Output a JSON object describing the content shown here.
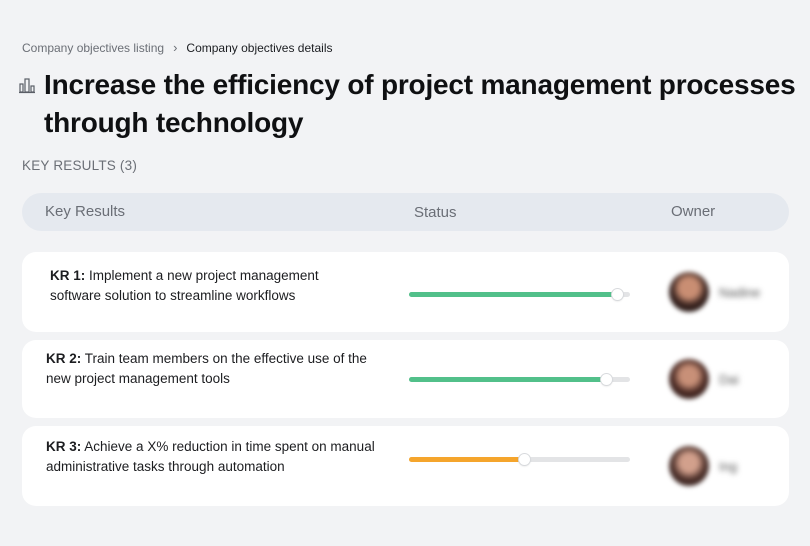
{
  "breadcrumb": {
    "parent": "Company objectives listing",
    "separator": "›",
    "current": "Company objectives details"
  },
  "title": "Increase the efficiency of project management processes through technology",
  "section_label": "KEY RESULTS (3)",
  "table": {
    "headers": {
      "key_results": "Key Results",
      "status": "Status",
      "owner": "Owner"
    }
  },
  "key_results": [
    {
      "code": "KR 1:",
      "text": "Implement a new project management software solution to streamline workflows",
      "progress": 0.94,
      "color": "#52c08a",
      "owner": "Nadine"
    },
    {
      "code": "KR 2:",
      "text": "Train team members on the effective use of the new project management tools",
      "progress": 0.89,
      "color": "#52c08a",
      "owner": "Dai"
    },
    {
      "code": "KR 3:",
      "text": "Achieve a X% reduction in time spent on manual administrative tasks through automation",
      "progress": 0.52,
      "color": "#f5a52c",
      "owner": "Ing"
    }
  ],
  "colors": {
    "background": "#f2f3f5",
    "header_bg": "#e5e9ef",
    "track": "#e3e4e6"
  },
  "icons": {
    "title_icon": "building-chart-icon"
  }
}
